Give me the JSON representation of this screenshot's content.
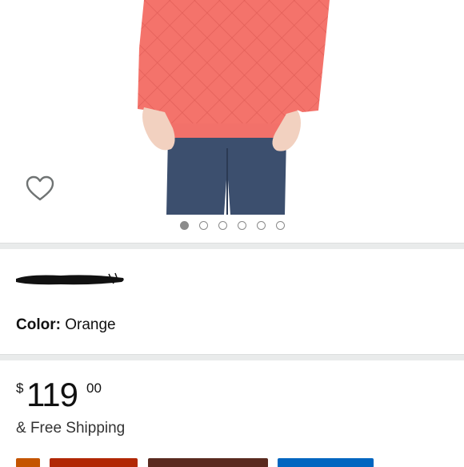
{
  "product": {
    "color_label": "Color:",
    "color_value": "Orange"
  },
  "price": {
    "currency": "$",
    "whole": "119",
    "fraction": "00"
  },
  "shipping": "& Free Shipping",
  "carousel": {
    "count": 6,
    "active_index": 0
  },
  "colors": {
    "garment": "#f4736b",
    "jeans": "#3c4f6e",
    "divider": "#e9ebeb"
  },
  "icons": {
    "wishlist": "heart-outline-icon"
  }
}
